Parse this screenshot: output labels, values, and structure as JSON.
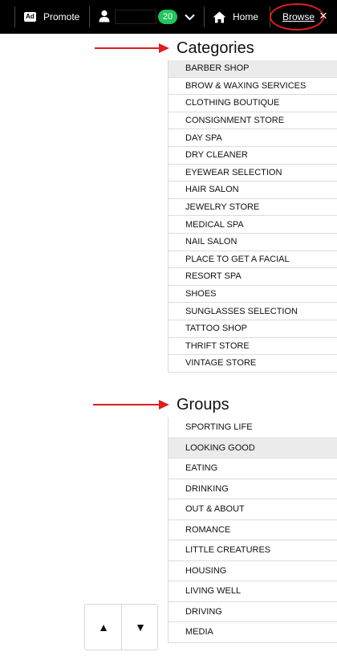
{
  "topbar": {
    "promote_icon": "Ad",
    "promote_label": "Promote",
    "user_icon": "user-icon",
    "notification_count": "20",
    "home_icon": "home-icon",
    "home_label": "Home",
    "browse_label": "Browse",
    "close_icon": "×"
  },
  "categories": {
    "title": "Categories",
    "items": [
      "BARBER SHOP",
      "BROW & WAXING SERVICES",
      "CLOTHING BOUTIQUE",
      "CONSIGNMENT STORE",
      "DAY SPA",
      "DRY CLEANER",
      "EYEWEAR SELECTION",
      "HAIR SALON",
      "JEWELRY STORE",
      "MEDICAL SPA",
      "NAIL SALON",
      "PLACE TO GET A FACIAL",
      "RESORT SPA",
      "SHOES",
      "SUNGLASSES SELECTION",
      "TATTOO SHOP",
      "THRIFT STORE",
      "VINTAGE STORE"
    ],
    "selected_index": 0
  },
  "groups": {
    "title": "Groups",
    "items": [
      "SPORTING LIFE",
      "LOOKING GOOD",
      "EATING",
      "DRINKING",
      "OUT & ABOUT",
      "ROMANCE",
      "LITTLE CREATURES",
      "HOUSING",
      "LIVING WELL",
      "DRIVING",
      "MEDIA"
    ],
    "selected_index": 1
  },
  "scroll": {
    "up_glyph": "▲",
    "down_glyph": "▼"
  },
  "colors": {
    "annotation_red": "#e11d1d",
    "badge_green": "#22c55e",
    "selected_row": "#ebebeb"
  }
}
